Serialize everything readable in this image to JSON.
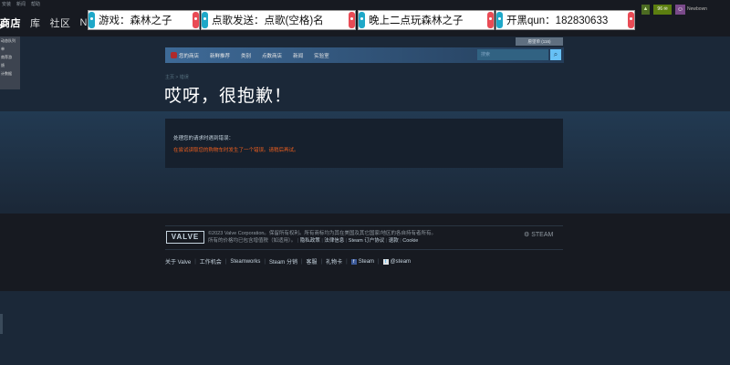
{
  "header": {
    "top_menu": [
      "安装",
      "新闻",
      "帮助"
    ],
    "nav": {
      "store": "商店",
      "library": "库",
      "community": "社区",
      "newt": "NEWT"
    }
  },
  "dropdown": {
    "items": [
      "动态队列",
      "单",
      "商荐游",
      "馈",
      "计数据"
    ]
  },
  "overlay": {
    "item1": "游戏：森林之子",
    "item2": "点歌发送：点歌(空格)名",
    "item3": "晚上二点玩森林之子",
    "item4": "开黑qun：182830633"
  },
  "account": {
    "count": "96",
    "name": "Newbown"
  },
  "store": {
    "wishlist": "愿望单 (116)",
    "nav": [
      "您的商店",
      "新鲜推荐",
      "类别",
      "点数商店",
      "新闻",
      "实验室"
    ],
    "search_placeholder": "搜索",
    "breadcrumb": "主页 > 错误",
    "title": "哎呀，很抱歉！",
    "error_heading": "处理您的请求时遇到错误：",
    "error_message": "在尝试读取您的购物车时发生了一个错误。请稍后再试。"
  },
  "footer": {
    "valve": "VALVE",
    "copyright_line1": "©2023 Valve Corporation。保留所有权利。所有商标均为其在美国及其它国家/地区的各自持有者所有。",
    "copyright_line2_prefix": "所有的价格均已包含增值税（如适用）。",
    "links_inline": [
      "隐私政策",
      "法律信息",
      "Steam 订户协议",
      "退款",
      "Cookie"
    ],
    "steam_logo": "STEAM",
    "links": [
      "关于 Valve",
      "工作机会",
      "Steamworks",
      "Steam 分销",
      "客服",
      "礼物卡"
    ],
    "facebook": "Steam",
    "twitter": "@steam"
  }
}
